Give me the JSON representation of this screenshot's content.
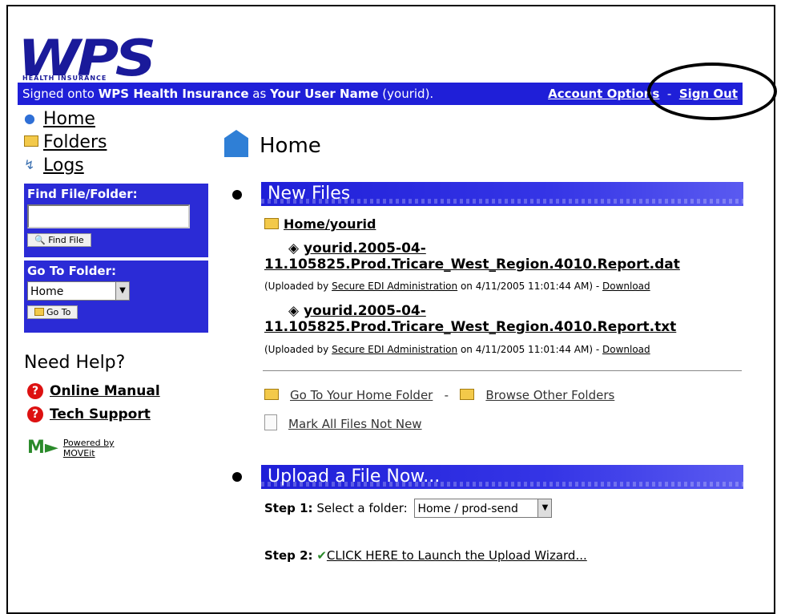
{
  "header": {
    "logo_text": "WPS",
    "logo_subtext": "HEALTH INSURANCE",
    "signed_prefix": "Signed onto ",
    "org": "WPS Health Insurance",
    "as_text": " as ",
    "user_label": "Your User Name",
    "user_id": " (yourid).",
    "account_options": "Account Options",
    "separator": "-",
    "sign_out": "Sign Out"
  },
  "nav": {
    "items": [
      {
        "label": "Home",
        "icon": "globe-icon"
      },
      {
        "label": "Folders",
        "icon": "folder-icon"
      },
      {
        "label": "Logs",
        "icon": "logs-icon"
      }
    ]
  },
  "find": {
    "title": "Find File/Folder:",
    "value": "",
    "button": "Find File"
  },
  "goto": {
    "title": "Go To Folder:",
    "selected": "Home",
    "button": "Go To"
  },
  "help": {
    "title": "Need Help?",
    "manual": "Online Manual",
    "support": "Tech Support",
    "powered_line1": "Powered by",
    "powered_line2": "MOVEit"
  },
  "main": {
    "title": "Home",
    "new_files": {
      "heading": "New Files",
      "folder": "Home/yourid",
      "files": [
        {
          "name_line1": "yourid.2005-04-",
          "name_line2": "11.105825.Prod.Tricare_West_Region.4010.Report.dat",
          "uploaded_prefix": "(Uploaded by ",
          "uploader": "Secure EDI Administration",
          "uploaded_suffix": " on 4/11/2005 11:01:44 AM) - ",
          "download": "Download"
        },
        {
          "name_line1": "yourid.2005-04-",
          "name_line2": "11.105825.Prod.Tricare_West_Region.4010.Report.txt",
          "uploaded_prefix": "(Uploaded by ",
          "uploader": "Secure EDI Administration",
          "uploaded_suffix": " on 4/11/2005 11:01:44 AM) - ",
          "download": "Download"
        }
      ],
      "go_home": "Go To Your Home Folder",
      "dash": "-",
      "browse": "Browse Other Folders",
      "mark_all": "Mark All Files Not New"
    },
    "upload": {
      "heading": "Upload a File Now...",
      "step1_label": "Step 1:",
      "step1_text": "Select a folder:",
      "step1_selected": "Home / prod-send",
      "step2_label": "Step 2:",
      "step2_link": "CLICK HERE to Launch the Upload Wizard..."
    }
  },
  "colors": {
    "bar_blue": "#1f1fd8",
    "logo_blue": "#1a1a9a"
  }
}
